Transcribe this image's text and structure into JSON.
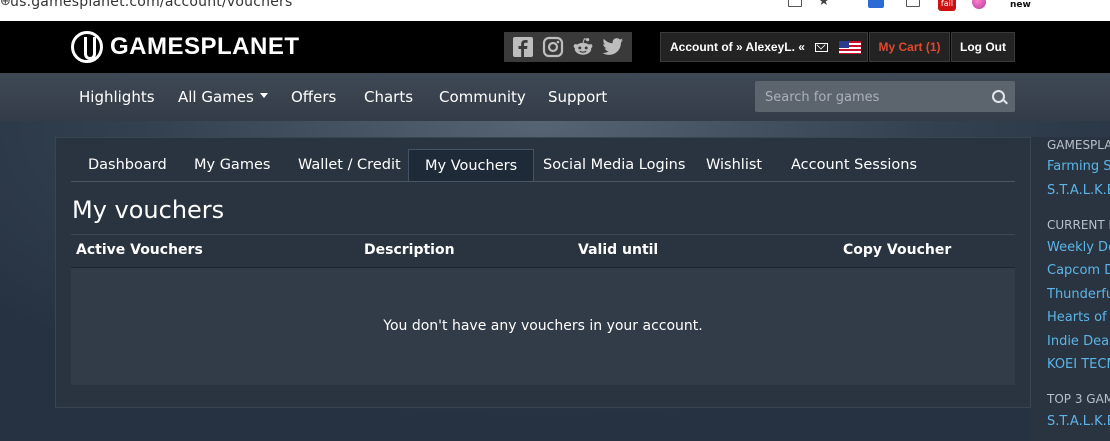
{
  "browser": {
    "url": "us.gamesplanet.com/account/vouchers",
    "ext_badge_label": "fail",
    "ext_new_label": "new"
  },
  "header": {
    "logo_text": "GAMESPLANET",
    "social": [
      "facebook-icon",
      "instagram-icon",
      "reddit-icon",
      "twitter-icon"
    ],
    "account_label": "Account of » AlexeyL. «",
    "cart_label": "My Cart (1)",
    "logout_label": "Log Out",
    "cart_color": "#e0492b"
  },
  "nav": {
    "items": [
      "Highlights",
      "All Games",
      "Offers",
      "Charts",
      "Community",
      "Support"
    ],
    "search_placeholder": "Search for games"
  },
  "account_tabs": {
    "items": [
      "Dashboard",
      "My Games",
      "Wallet / Credit",
      "My Vouchers",
      "Social Media Logins",
      "Wishlist",
      "Account Sessions"
    ],
    "active": "My Vouchers"
  },
  "vouchers": {
    "title": "My vouchers",
    "columns": [
      "Active Vouchers",
      "Description",
      "Valid until",
      "Copy Voucher"
    ],
    "empty_message": "You don't have any vouchers in your account."
  },
  "sidebar": {
    "headings": [
      "GAMESPLAN",
      "CURRENT P",
      "TOP 3 GAM"
    ],
    "links": [
      "Farming Si",
      "S.T.A.L.K.E.",
      "Weekly De",
      "Capcom D",
      "Thunderfu",
      "Hearts of I",
      "Indie Deals",
      "KOEI TECM",
      "S.T.A.L.K.E."
    ],
    "link_color": "#5cb5e8"
  }
}
